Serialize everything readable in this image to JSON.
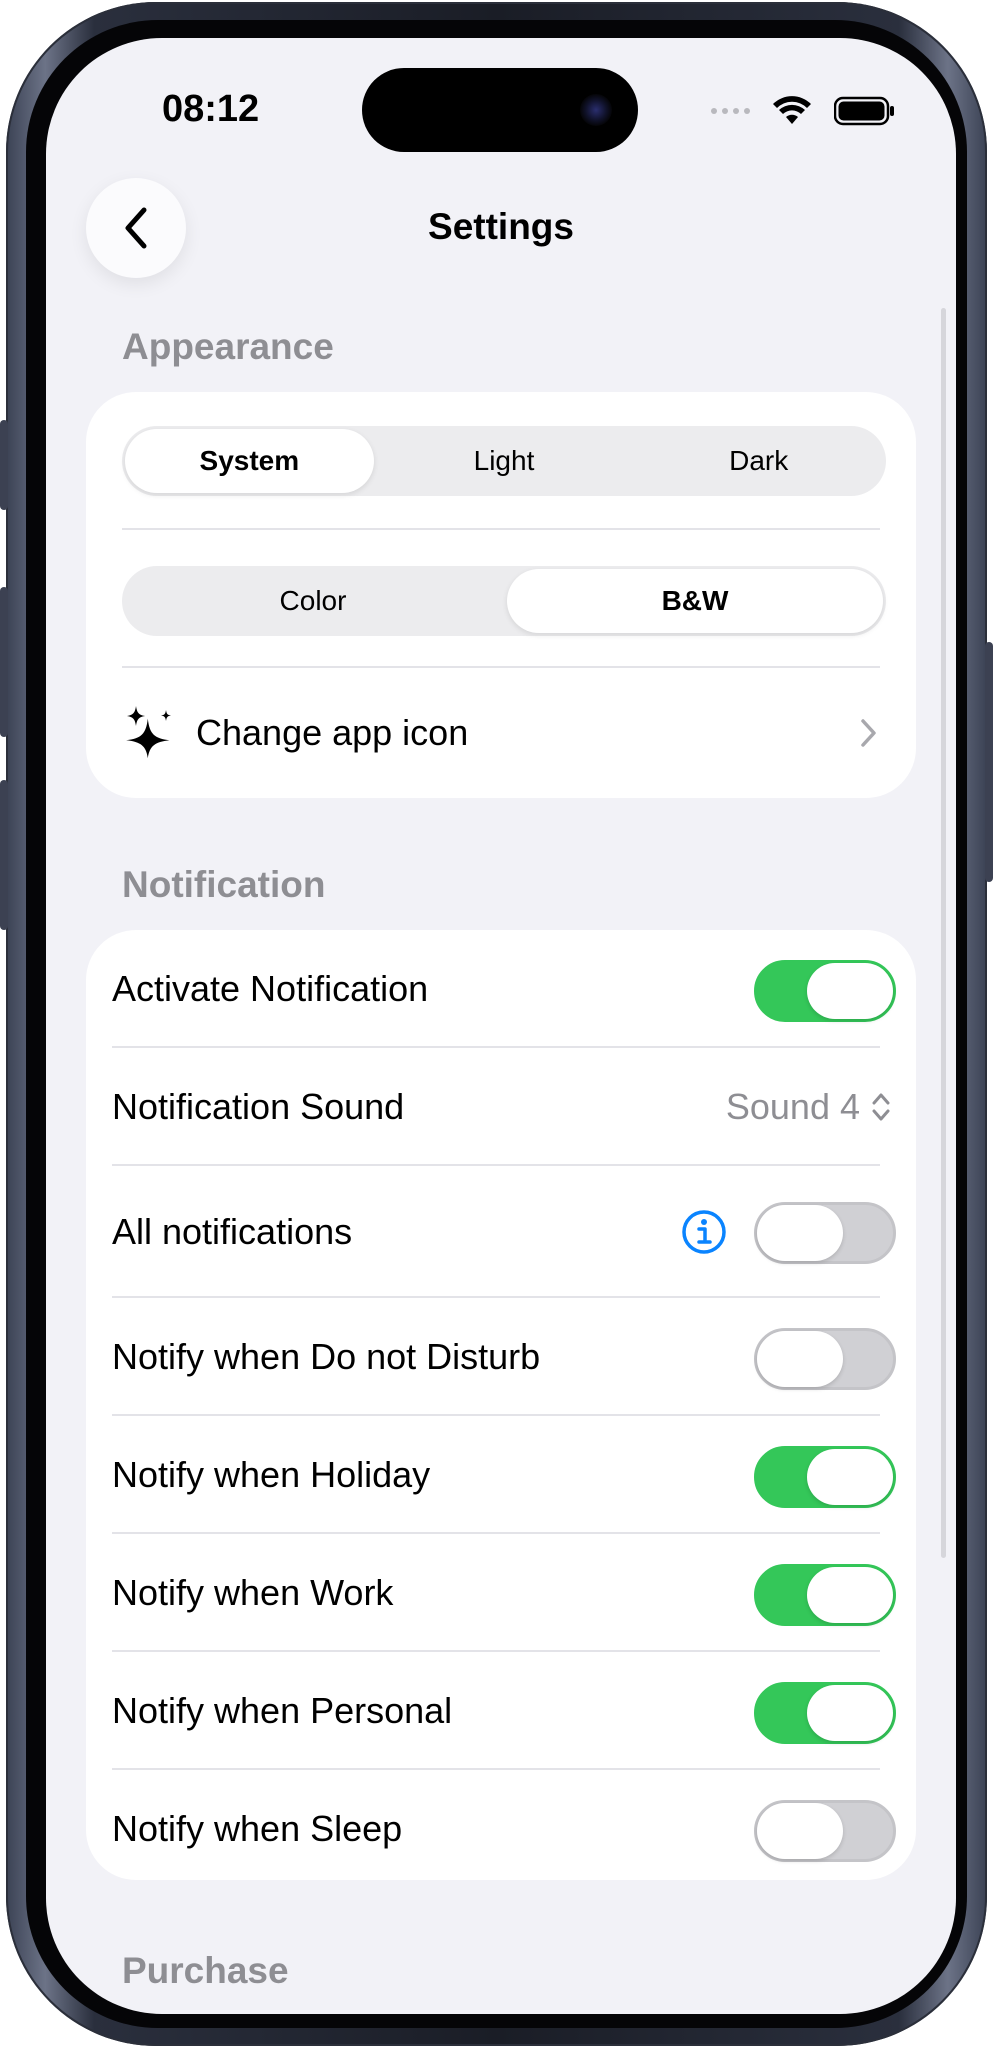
{
  "status": {
    "time": "08:12"
  },
  "nav": {
    "title": "Settings"
  },
  "appearance": {
    "section_title": "Appearance",
    "theme_options": [
      "System",
      "Light",
      "Dark"
    ],
    "theme_selected": "System",
    "color_options": [
      "Color",
      "B&W"
    ],
    "color_selected": "B&W",
    "change_icon_label": "Change app icon"
  },
  "notification": {
    "section_title": "Notification",
    "rows": [
      {
        "label": "Activate Notification",
        "enabled": true
      },
      {
        "label": "Notification Sound",
        "value": "Sound 4"
      },
      {
        "label": "All notifications",
        "enabled": false,
        "info": true
      },
      {
        "label": "Notify when Do not Disturb",
        "enabled": false
      },
      {
        "label": "Notify when Holiday",
        "enabled": true
      },
      {
        "label": "Notify when Work",
        "enabled": true
      },
      {
        "label": "Notify when Personal",
        "enabled": true
      },
      {
        "label": "Notify when Sleep",
        "enabled": false
      }
    ]
  },
  "purchase": {
    "section_title": "Purchase"
  },
  "colors": {
    "toggle_on": "#34c759",
    "accent_info": "#0a84ff",
    "background": "#f2f2f7"
  },
  "icons": [
    "back-chevron-icon",
    "sparkles-icon",
    "chevron-right-icon",
    "updown-chevron-icon",
    "info-icon",
    "wifi-icon",
    "battery-icon"
  ]
}
